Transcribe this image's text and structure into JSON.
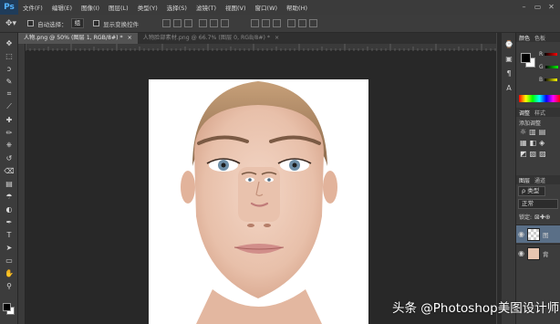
{
  "app": {
    "logo": "Ps",
    "menu": [
      "文件(F)",
      "编辑(E)",
      "图像(I)",
      "图层(L)",
      "类型(Y)",
      "选择(S)",
      "滤镜(T)",
      "视图(V)",
      "窗口(W)",
      "帮助(H)"
    ]
  },
  "options": {
    "auto_select_label": "自动选择：",
    "auto_select_value": "组",
    "show_transform_label": "显示变换控件"
  },
  "tabs": [
    {
      "label": "人物.png @ 50% (图层 1, RGB/8#) *",
      "active": true
    },
    {
      "label": "人物脸部素材.png @ 66.7% (图层 0, RGB/8#) *",
      "active": false
    }
  ],
  "tools": [
    "move-icon",
    "marquee-icon",
    "lasso-icon",
    "quick-select-icon",
    "crop-icon",
    "eyedropper-icon",
    "healing-icon",
    "brush-icon",
    "stamp-icon",
    "history-brush-icon",
    "eraser-icon",
    "gradient-icon",
    "blur-icon",
    "dodge-icon",
    "pen-icon",
    "type-icon",
    "path-select-icon",
    "shape-icon",
    "hand-icon",
    "zoom-icon"
  ],
  "tool_glyphs": [
    "✥",
    "⬚",
    "ↄ",
    "✎",
    "⌗",
    "⟋",
    "✚",
    "✏",
    "⎈",
    "↺",
    "⌫",
    "▤",
    "☂",
    "◐",
    "✒",
    "T",
    "➤",
    "▭",
    "✋",
    "⚲"
  ],
  "panels": {
    "color_tab": "颜色",
    "swatches_tab": "色板",
    "adjust_tab": "调整",
    "styles_tab": "样式",
    "add_adjust": "添加调整",
    "layers_tab": "图层",
    "channels_tab": "通道",
    "kind_label": "ρ 类型",
    "blend_mode": "正常",
    "lock_label": "锁定:",
    "layers": [
      {
        "name": "图",
        "active": true
      },
      {
        "name": "背",
        "active": false
      }
    ],
    "slider_labels": [
      "R",
      "G",
      "B"
    ]
  },
  "watermark": "头条 @Photoshop美图设计师",
  "colors": {
    "accent": "#55b4ff",
    "layer_active": "#5a6f87"
  }
}
